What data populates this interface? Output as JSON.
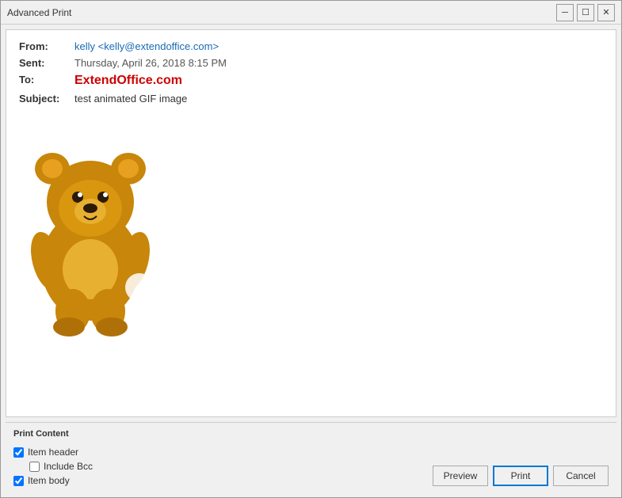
{
  "window": {
    "title": "Advanced Print",
    "minimize_label": "─",
    "maximize_label": "☐",
    "close_label": "✕"
  },
  "email": {
    "from_label": "From:",
    "from_value": "kelly <kelly@extendoffice.com>",
    "sent_label": "Sent:",
    "sent_value": "Thursday, April 26, 2018 8:15 PM",
    "to_label": "To:",
    "to_value": "ExtendOffice.com",
    "subject_label": "Subject:",
    "subject_value": "test animated GIF image"
  },
  "print_content": {
    "section_label": "Print Content",
    "item_header_label": "Item header",
    "include_bcc_label": "Include Bcc",
    "item_body_label": "Item body",
    "item_header_checked": true,
    "include_bcc_checked": false,
    "item_body_checked": true
  },
  "buttons": {
    "preview_label": "Preview",
    "print_label": "Print",
    "cancel_label": "Cancel"
  }
}
